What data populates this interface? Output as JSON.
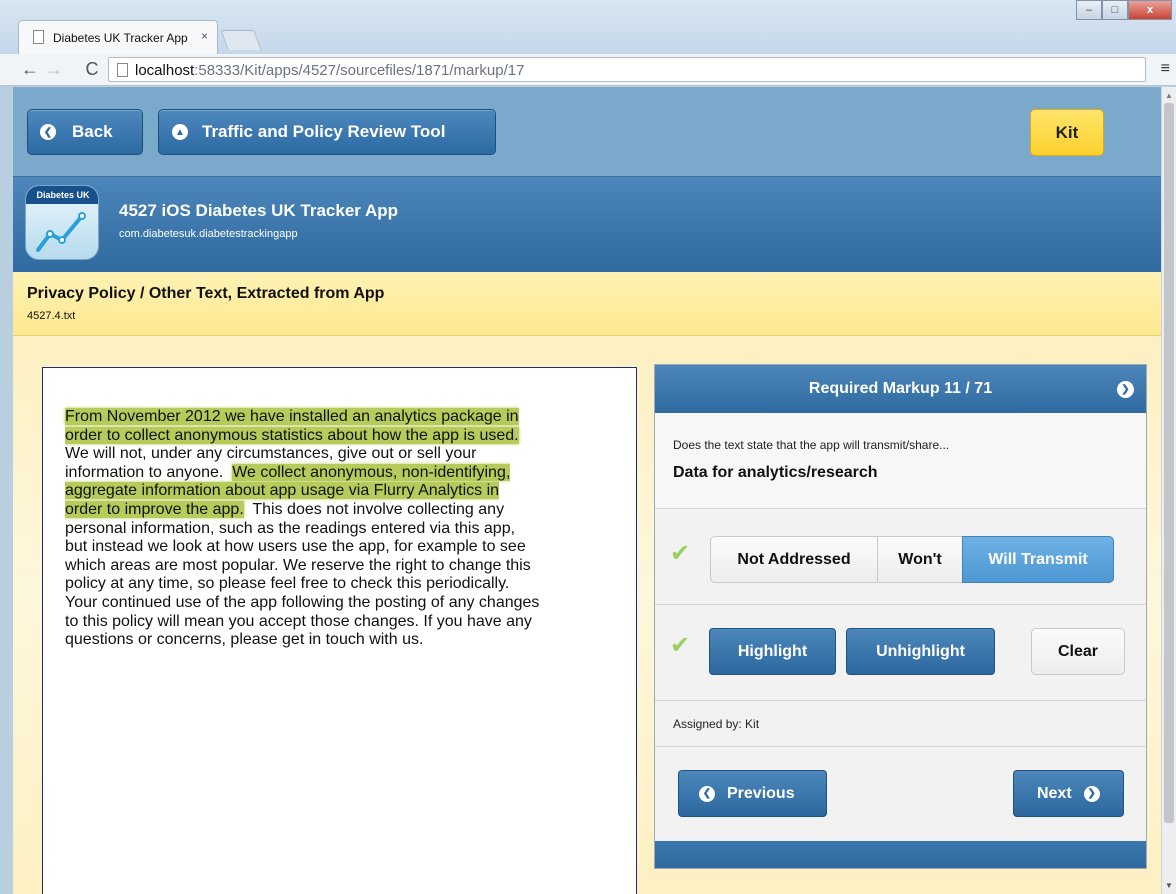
{
  "browser": {
    "tab_title": "Diabetes UK Tracker App",
    "tab_close": "×",
    "url_host": "localhost",
    "url_path": ":58333/Kit/apps/4527/sourcefiles/1871/markup/17",
    "menu_icon": "≡",
    "back_icon": "←",
    "forward_icon": "→",
    "reload_icon": "C"
  },
  "window_controls": {
    "minimize": "–",
    "maximize": "□",
    "close": "x"
  },
  "topbar": {
    "back_label": "Back",
    "home_label": "Traffic and Policy Review Tool",
    "user_label": "Kit"
  },
  "app": {
    "icon_text": "Diabetes UK",
    "title": "4527  iOS  Diabetes UK Tracker App",
    "bundle_id": "com.diabetesuk.diabetestrackingapp"
  },
  "document": {
    "title": "Privacy Policy / Other Text, Extracted from App",
    "filename": "4527.4.txt"
  },
  "policy": {
    "lines": [
      "From November 2012 we have installed an analytics package in",
      "order to collect anonymous statistics about how the app is used.",
      "We will not, under any circumstances, give out or sell your",
      "information to anyone.",
      "We collect anonymous, non-identifying,",
      "aggregate information about app usage via Flurry Analytics in",
      "order to improve the app.",
      "This does not involve collecting any",
      "personal information, such as the readings entered via this app,",
      "but instead we look at how users use the app, for example to see",
      "which areas are most popular.  We reserve the right to change this",
      "policy at any time, so please feel free to check this periodically.",
      "Your continued use of the app following the posting of any changes",
      "to this policy will mean you accept those changes.  If you have any",
      "questions or concerns, please get in touch with us."
    ]
  },
  "markup": {
    "header": "Required Markup 11 / 71",
    "question_prompt": "Does the text state that the app will transmit/share...",
    "question": "Data for analytics/research",
    "options": [
      "Not Addressed",
      "Won't",
      "Will Transmit"
    ],
    "selected_option": "Will Transmit",
    "highlight_label": "Highlight",
    "unhighlight_label": "Unhighlight",
    "clear_label": "Clear",
    "assigned_by": "Assigned by: Kit",
    "previous_label": "Previous",
    "next_label": "Next"
  },
  "colors": {
    "highlight": "#b6cb5a",
    "accent_blue": "#2f6aa0",
    "selected_blue": "#5aa3dc",
    "kit_yellow": "#fbd12c",
    "check_green": "#9bd061"
  }
}
